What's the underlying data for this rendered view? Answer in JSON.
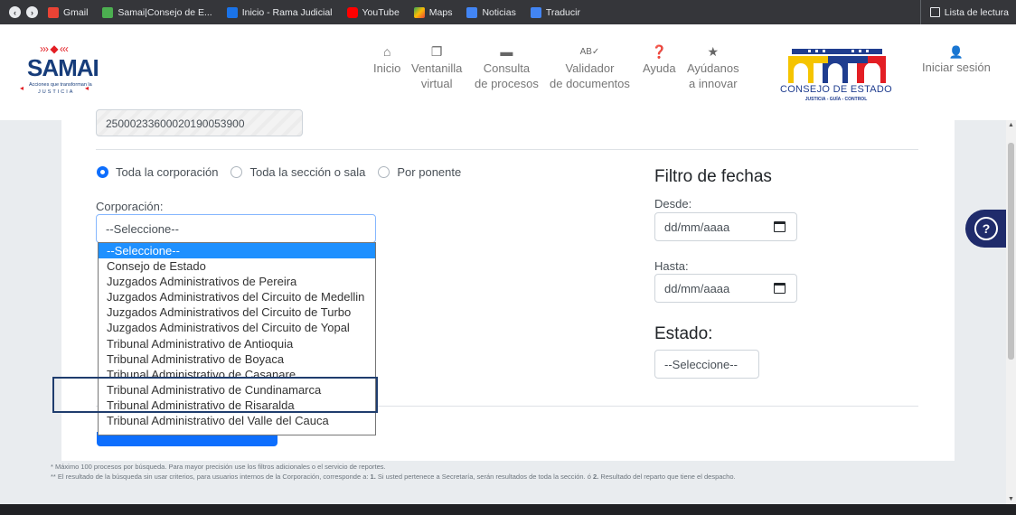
{
  "browser": {
    "bookmarks": [
      {
        "label": "Gmail",
        "icon": "gmail-icon",
        "color": "#ea4335"
      },
      {
        "label": "Samai|Consejo de E...",
        "icon": "samai-favicon",
        "color": "#4caf50"
      },
      {
        "label": "Inicio - Rama Judicial",
        "icon": "rama-judicial-icon",
        "color": "#1a73e8"
      },
      {
        "label": "YouTube",
        "icon": "youtube-icon",
        "color": "#ff0000"
      },
      {
        "label": "Maps",
        "icon": "maps-icon",
        "color": "#34a853"
      },
      {
        "label": "Noticias",
        "icon": "news-icon",
        "color": "#4285f4"
      },
      {
        "label": "Traducir",
        "icon": "translate-icon",
        "color": "#4285f4"
      }
    ],
    "reading_list": "Lista de lectura"
  },
  "header": {
    "logo": {
      "name": "SAMAI",
      "subtitle": "Acciones que transforman la",
      "subtitle2": "JUSTICIA"
    },
    "nav": [
      {
        "label": "Inicio",
        "icon": "home-icon",
        "glyph": "🏠"
      },
      {
        "label": "Ventanilla\nvirtual",
        "line1": "Ventanilla",
        "line2": "virtual",
        "icon": "window-icon",
        "glyph": "❐"
      },
      {
        "label": "Consulta\nde procesos",
        "line1": "Consulta",
        "line2": "de procesos",
        "icon": "folder-icon",
        "glyph": "▬"
      },
      {
        "label": "Validador\nde documentos",
        "line1": "Validador",
        "line2": "de documentos",
        "icon": "spellcheck-icon",
        "glyph": "ᴬᴮ"
      },
      {
        "label": "Ayuda",
        "icon": "question-icon",
        "glyph": "?"
      },
      {
        "label": "Ayúdanos\na innovar",
        "line1": "Ayúdanos",
        "line2": "a innovar",
        "icon": "star-icon",
        "glyph": "★"
      }
    ],
    "institution_logo": {
      "title": "CONSEJO DE ESTADO",
      "tagline": "JUSTICIA - GUÍA - CONTROL"
    },
    "login": "Iniciar sesión"
  },
  "form": {
    "radicado_value": "25000233600020190053900",
    "radios": [
      {
        "label": "Toda la corporación",
        "checked": true
      },
      {
        "label": "Toda la sección o sala",
        "checked": false
      },
      {
        "label": "Por ponente",
        "checked": false
      }
    ],
    "corporacion_label": "Corporación:",
    "corporacion_selected": "--Seleccione--",
    "corporacion_options": [
      "--Seleccione--",
      "Consejo de Estado",
      "Juzgados Administrativos de Pereira",
      "Juzgados Administrativos del Circuito de Medellin",
      "Juzgados Administrativos del Circuito de Turbo",
      "Juzgados Administrativos del Circuito de Yopal",
      "Tribunal Administrativo de Antioquia",
      "Tribunal Administrativo de Boyaca",
      "Tribunal Administrativo de Casanare",
      "Tribunal Administrativo de Cundinamarca",
      "Tribunal Administrativo de Risaralda",
      "Tribunal Administrativo del Valle del Cauca"
    ],
    "highlighted_option": "Tribunal Administrativo de Cundinamarca"
  },
  "filters": {
    "title": "Filtro de fechas",
    "desde_label": "Desde:",
    "desde_placeholder": "dd/mm/aaaa",
    "hasta_label": "Hasta:",
    "hasta_placeholder": "dd/mm/aaaa",
    "estado_title": "Estado:",
    "estado_selected": "--Seleccione--"
  },
  "notes": {
    "line1": "* Máximo 100 procesos por búsqueda. Para mayor precisión use los filtros adicionales o el servicio de reportes.",
    "line2_prefix": "** El resultado de la búsqueda sin usar criterios, para usuarios internos de la Corporación, corresponde a: ",
    "n1": "1.",
    "line2_mid": " Si usted pertenece a Secretaría, serán resultados de toda la sección. ó ",
    "n2": "2.",
    "line2_suffix": " Resultado del reparto que tiene el despacho."
  },
  "help_label": "?"
}
